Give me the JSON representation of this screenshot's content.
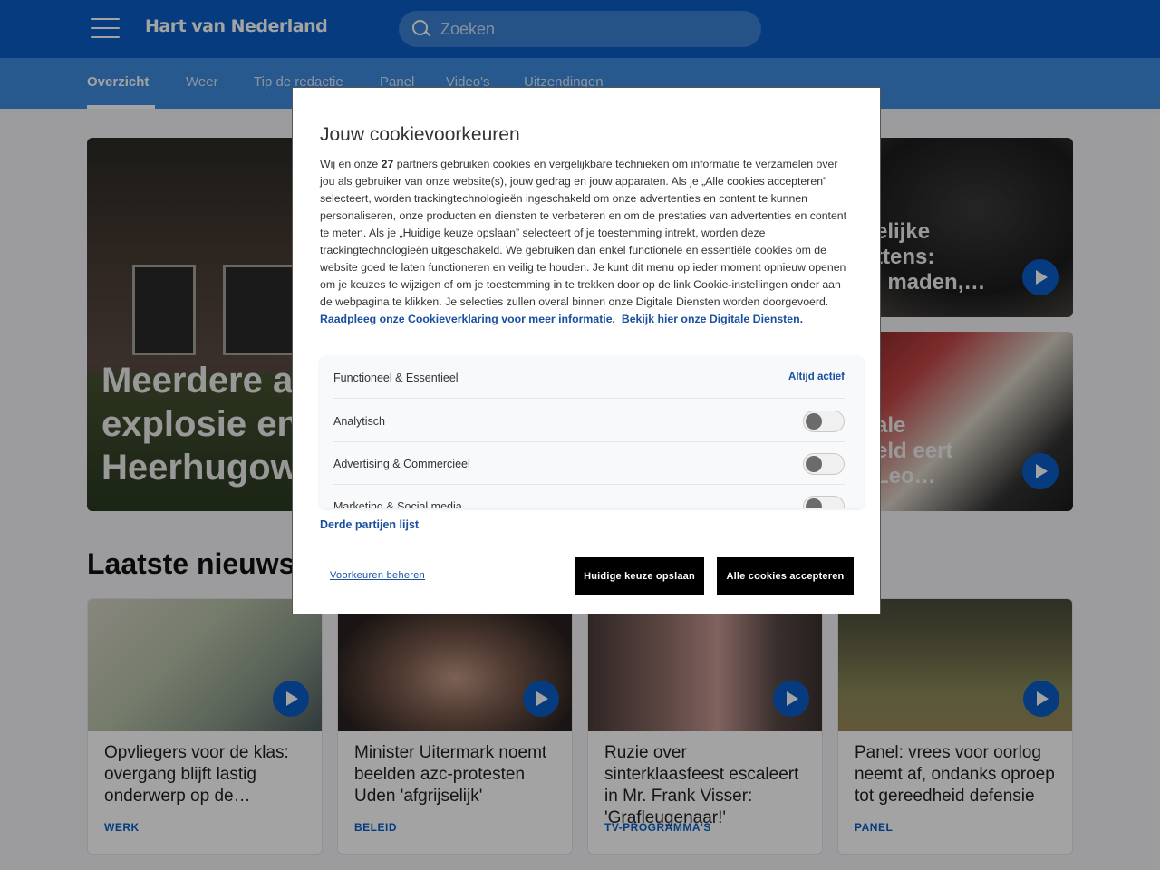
{
  "header": {
    "logo_text": "Hart van Nederland",
    "search_placeholder": "Zoeken"
  },
  "nav": {
    "tabs": [
      "Overzicht",
      "Weer",
      "Tip de redactie",
      "Panel",
      "Video's",
      "Uitzendingen"
    ],
    "active": "Overzicht"
  },
  "hero": {
    "main_title": "Meerdere a… explosie en Heerhugow…",
    "main_lines": [
      "Meerdere a",
      "explosie en",
      "Heerhugow"
    ],
    "side1_lines": [
      "elijke",
      "ttens:",
      "l maden,…"
    ],
    "side2_lines": [
      "ale",
      "eld eert",
      "Leo…"
    ]
  },
  "latest": {
    "title": "Laatste nieuws",
    "cards": [
      {
        "title": "Opvliegers voor de klas: overgang blijft lastig onderwerp op de…",
        "tag": "WERK"
      },
      {
        "title": "Minister Uitermark noemt beelden azc-protesten Uden 'afgrijselijk'",
        "tag": "BELEID"
      },
      {
        "title": "Ruzie over sinterklaasfeest escaleert in Mr. Frank Visser: 'Grafleugenaar!'",
        "tag": "TV-PROGRAMMA'S"
      },
      {
        "title": "Panel: vrees voor oorlog neemt af, ondanks oproep tot gereedheid defensie",
        "tag": "PANEL"
      }
    ]
  },
  "cookie_modal": {
    "title": "Jouw cookievoorkeuren",
    "text_before_count": "Wij en onze ",
    "partner_count": "27",
    "text_after_count": " partners gebruiken cookies en vergelijkbare technieken om informatie te verzamelen over jou als gebruiker van onze website(s), jouw gedrag en jouw apparaten. Als je „Alle cookies accepteren” selecteert, worden trackingtechnologieën ingeschakeld om onze advertenties en content te kunnen personaliseren, onze producten en diensten te verbeteren en om de prestaties van advertenties en content te meten. Als je „Huidige keuze opslaan” selecteert of je toestemming intrekt, worden deze trackingtechnologieën uitgeschakeld. We gebruiken dan enkel functionele en essentiële cookies om de website goed te laten functioneren en veilig te houden. Je kunt dit menu op ieder moment opnieuw openen om je keuzes te wijzigen of om je toestemming in te trekken door op de link Cookie-instellingen onder aan de webpagina te klikken. Je selecties zullen overal binnen onze Digitale Diensten worden doorgevoerd. ",
    "link_cookie_statement": "Raadpleeg onze Cookieverklaring voor meer informatie.",
    "link_digital_services": "Bekijk hier onze Digitale Diensten.",
    "preferences": [
      {
        "label": "Functioneel & Essentieel",
        "status": "Altijd actief"
      },
      {
        "label": "Analytisch"
      },
      {
        "label": "Advertising & Commercieel"
      },
      {
        "label": "Marketing & Social media"
      }
    ],
    "third_party_link": "Derde partijen lijst",
    "manage_link": "Voorkeuren beheren",
    "save_button": "Huidige keuze opslaan",
    "accept_button": "Alle cookies accepteren"
  }
}
